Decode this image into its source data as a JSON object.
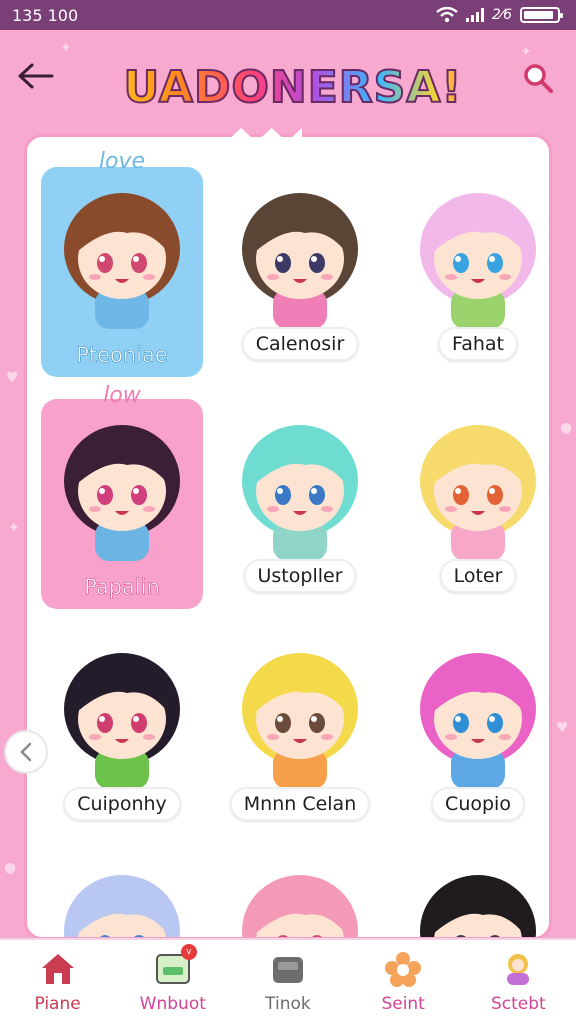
{
  "status_bar": {
    "time": "135 100",
    "network": "2⁄6"
  },
  "header": {
    "title": "UADONERSA!"
  },
  "characters": [
    {
      "name": "Pteoniae",
      "tag": "love",
      "selected": "blue",
      "hair": "#8a4a2c",
      "shirt": "#6fb7e6",
      "eyes": "#d0486f"
    },
    {
      "name": "Calenosir",
      "tag": "",
      "selected": "",
      "hair": "#5a4436",
      "shirt": "#f07fb8",
      "eyes": "#3d3a66"
    },
    {
      "name": "Fahat",
      "tag": "",
      "selected": "",
      "hair": "#f2b8ea",
      "shirt": "#9ad36b",
      "eyes": "#39a2e0"
    },
    {
      "name": "Papalin",
      "tag": "low",
      "selected": "pink",
      "hair": "#3b1f37",
      "shirt": "#6bb4e4",
      "eyes": "#d03e7e"
    },
    {
      "name": "Ustopller",
      "tag": "",
      "selected": "",
      "hair": "#6fdcd2",
      "shirt": "#8fd6c8",
      "eyes": "#3b79c6"
    },
    {
      "name": "Loter",
      "tag": "",
      "selected": "",
      "hair": "#f6da6b",
      "shirt": "#f7a8c8",
      "eyes": "#e36336"
    },
    {
      "name": "Cuiponhy",
      "tag": "",
      "selected": "",
      "hair": "#241c2a",
      "shirt": "#6cc24a",
      "eyes": "#cf3d6e"
    },
    {
      "name": "Mnnn Celan",
      "tag": "",
      "selected": "",
      "hair": "#f4d94a",
      "shirt": "#f7a04b",
      "eyes": "#6b4c3a"
    },
    {
      "name": "Cuopio",
      "tag": "",
      "selected": "",
      "hair": "#ea62c6",
      "shirt": "#5da8e4",
      "eyes": "#2f8fd6"
    },
    {
      "name": "",
      "tag": "",
      "selected": "",
      "hair": "#b8c8f2",
      "shirt": "#e9a0cf",
      "eyes": "#3f86d0"
    },
    {
      "name": "",
      "tag": "",
      "selected": "",
      "hair": "#f49ab6",
      "shirt": "#f7b7cd",
      "eyes": "#d0486f"
    },
    {
      "name": "",
      "tag": "",
      "selected": "",
      "hair": "#1f1b1f",
      "shirt": "#f3a245",
      "eyes": "#3a3a4a"
    }
  ],
  "nav": [
    {
      "label": "Piane",
      "color": "#c93c52",
      "icon": "home-icon"
    },
    {
      "label": "Wnbuot",
      "color": "#d04496",
      "icon": "inbox-icon",
      "badge": "v"
    },
    {
      "label": "Tinok",
      "color": "#6d6d6d",
      "icon": "ticket-icon"
    },
    {
      "label": "Seint",
      "color": "#d04496",
      "icon": "flower-icon"
    },
    {
      "label": "Sctebt",
      "color": "#d04496",
      "icon": "character-icon"
    }
  ],
  "colors": {
    "accent": "#f7a9cf",
    "status_bar": "#7b3f78"
  }
}
